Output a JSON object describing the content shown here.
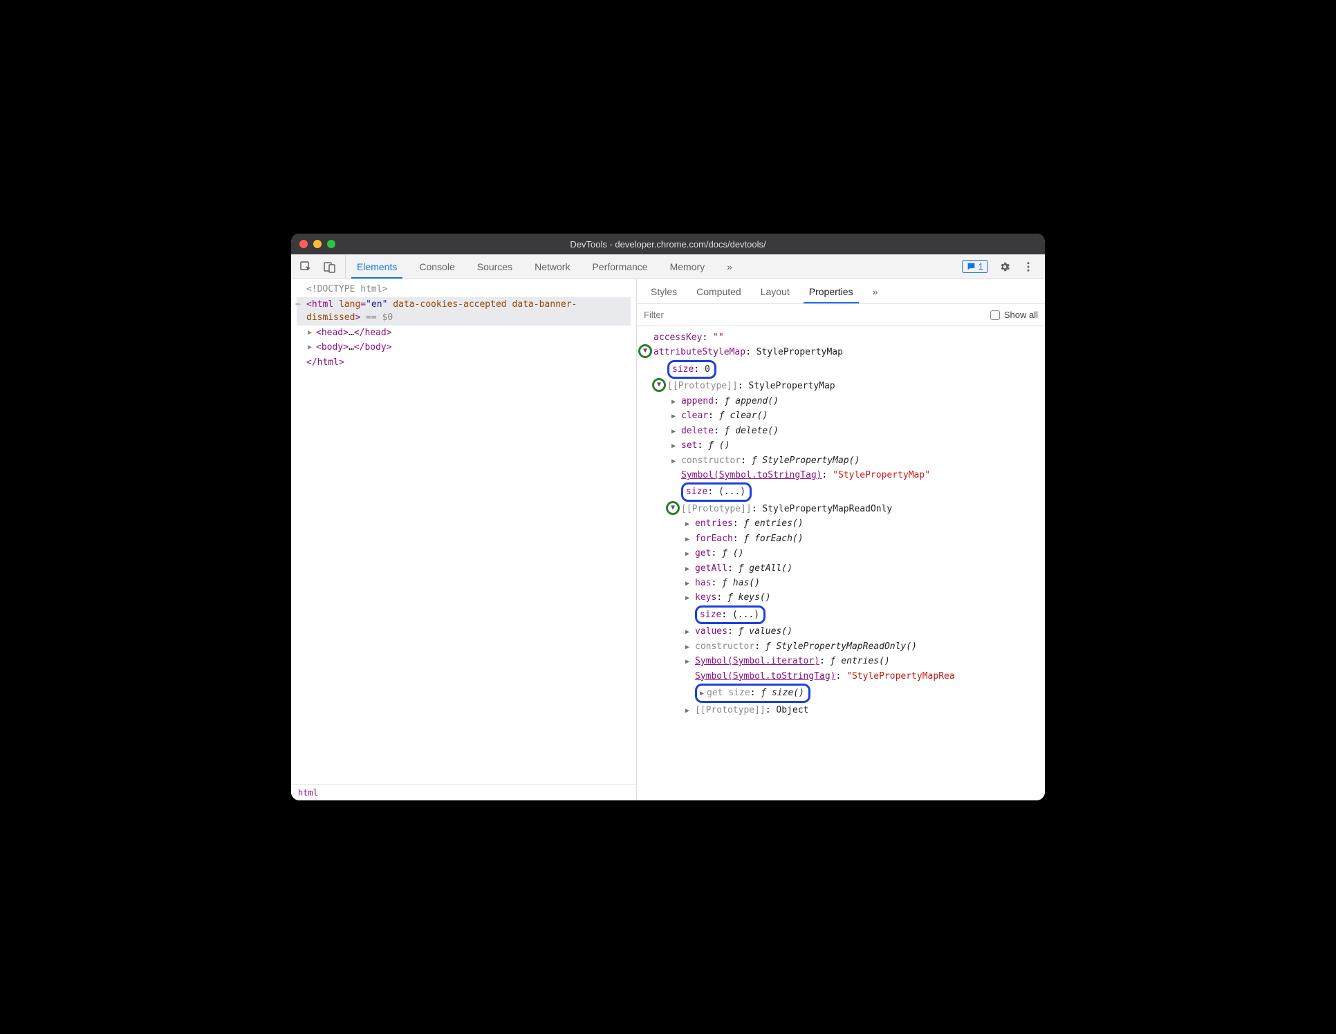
{
  "window": {
    "title": "DevTools - developer.chrome.com/docs/devtools/"
  },
  "mainTabs": {
    "items": [
      "Elements",
      "Console",
      "Sources",
      "Network",
      "Performance",
      "Memory"
    ],
    "more": "»",
    "active": "Elements"
  },
  "toolbar": {
    "issues_count": "1"
  },
  "dom": {
    "doctype": "<!DOCTYPE html>",
    "html_open": "<html lang=\"en\" data-cookies-accepted data-banner-dismissed>",
    "eq0": " == $0",
    "head": "<head>…</head>",
    "body": "<body>…</body>",
    "html_close": "</html>"
  },
  "breadcrumb": {
    "path": "html"
  },
  "sideTabs": {
    "items": [
      "Styles",
      "Computed",
      "Layout",
      "Properties"
    ],
    "more": "»",
    "active": "Properties"
  },
  "filter": {
    "placeholder": "Filter",
    "show_all_label": "Show all"
  },
  "props": {
    "accessKey_name": "accessKey",
    "accessKey_val": "\"\"",
    "attributeStyleMap_name": "attributeStyleMap",
    "attributeStyleMap_val": "StylePropertyMap",
    "size0_name": "size",
    "size0_val": "0",
    "proto1_name": "[[Prototype]]",
    "proto1_val": "StylePropertyMap",
    "append_name": "append",
    "append_val": "append()",
    "clear_name": "clear",
    "clear_val": "clear()",
    "delete_name": "delete",
    "delete_val": "delete()",
    "set_name": "set",
    "set_val": "()",
    "constructor1_name": "constructor",
    "constructor1_val": "StylePropertyMap()",
    "symTag1_name": "Symbol(Symbol.toStringTag)",
    "symTag1_val": "\"StylePropertyMap\"",
    "sizeE1_name": "size",
    "sizeE1_val": "(...)",
    "proto2_name": "[[Prototype]]",
    "proto2_val": "StylePropertyMapReadOnly",
    "entries_name": "entries",
    "entries_val": "entries()",
    "forEach_name": "forEach",
    "forEach_val": "forEach()",
    "get_name": "get",
    "get_val": "()",
    "getAll_name": "getAll",
    "getAll_val": "getAll()",
    "has_name": "has",
    "has_val": "has()",
    "keys_name": "keys",
    "keys_val": "keys()",
    "sizeE2_name": "size",
    "sizeE2_val": "(...)",
    "values_name": "values",
    "values_val": "values()",
    "constructor2_name": "constructor",
    "constructor2_val": "StylePropertyMapReadOnly()",
    "symIter_name": "Symbol(Symbol.iterator)",
    "symIter_val": "entries()",
    "symTag2_name": "Symbol(Symbol.toStringTag)",
    "symTag2_val": "\"StylePropertyMapRea",
    "getSize_name": "get size",
    "getSize_val": "size()",
    "proto3_name": "[[Prototype]]",
    "proto3_val": "Object",
    "f": "ƒ "
  }
}
